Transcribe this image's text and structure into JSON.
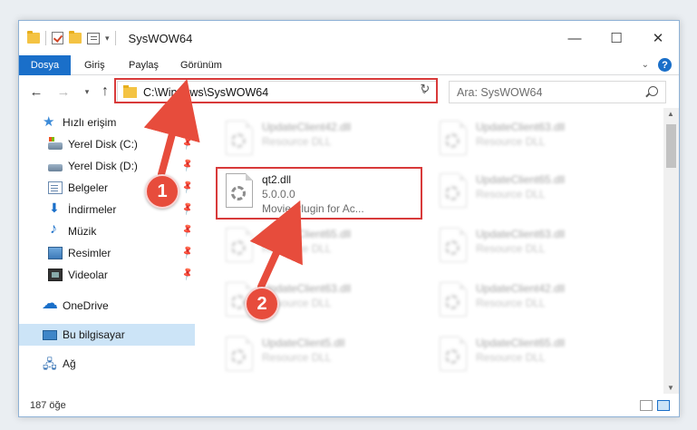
{
  "window": {
    "title": "SysWOW64",
    "minimize_glyph": "—",
    "maximize_glyph": "☐",
    "close_glyph": "✕"
  },
  "ribbon": {
    "tabs": [
      "Dosya",
      "Giriş",
      "Paylaş",
      "Görünüm"
    ],
    "help": "?",
    "active_color": "#1a6fc9"
  },
  "address": {
    "path": "C:\\Windows\\SysWOW64",
    "search_placeholder": "Ara: SysWOW64"
  },
  "nav_pane": {
    "quick_access": "Hızlı erişim",
    "items": [
      {
        "label": "Yerel Disk (C:)",
        "icon": "drive-icon"
      },
      {
        "label": "Yerel Disk (D:)",
        "icon": "drive-icon"
      },
      {
        "label": "Belgeler",
        "icon": "documents-icon"
      },
      {
        "label": "İndirmeler",
        "icon": "download-icon"
      },
      {
        "label": "Müzik",
        "icon": "music-icon"
      },
      {
        "label": "Resimler",
        "icon": "pictures-icon"
      },
      {
        "label": "Videolar",
        "icon": "video-icon"
      }
    ],
    "onedrive": "OneDrive",
    "this_pc": "Bu bilgisayar",
    "network": "Ağ",
    "selected_color": "#cce4f7"
  },
  "files": {
    "left_column": [
      {
        "name": "UpdateClient42.dll",
        "type": "Resource DLL"
      },
      {
        "name": "qt2.dll",
        "version": "5.0.0.0",
        "description": "Movie Plugin for Ac..."
      },
      {
        "name": "UpdateClient65.dll",
        "type": "Resource DLL"
      },
      {
        "name": "UpdateClient63.dll",
        "type": "Resource DLL"
      },
      {
        "name": "UpdateClient5.dll",
        "type": "Resource DLL"
      }
    ],
    "right_column": [
      {
        "name": "UpdateClient63.dll",
        "type": "Resource DLL"
      },
      {
        "name": "UpdateClient65.dll",
        "type": "Resource DLL"
      },
      {
        "name": "UpdateClient63.dll",
        "type": "Resource DLL"
      },
      {
        "name": "UpdateClient42.dll",
        "type": "Resource DLL"
      },
      {
        "name": "UpdateClient65.dll",
        "type": "Resource DLL"
      }
    ]
  },
  "status": {
    "item_count": "187 öğe"
  },
  "annotations": {
    "step1": "1",
    "step2": "2",
    "color": "#d83a3a"
  }
}
